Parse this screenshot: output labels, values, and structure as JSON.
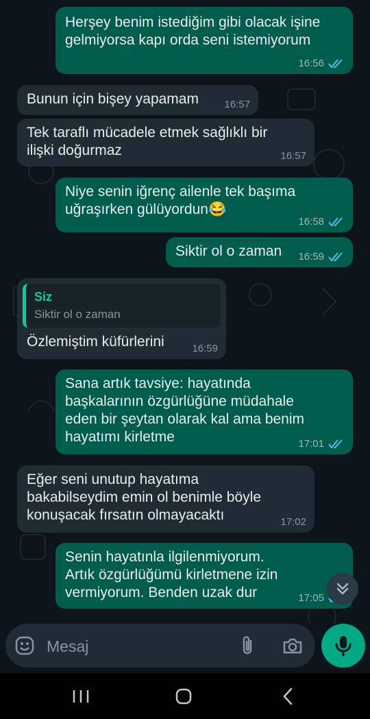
{
  "messages": [
    {
      "text": "Herşey benim istediğim gibi olacak işine gelmiyorsa kapı orda seni istemiyorum",
      "time": "16:56"
    },
    {
      "text": "Bunun için bişey yapamam",
      "time": "16:57"
    },
    {
      "text": "Tek taraflı mücadele etmek sağlıklı bir ilişki doğurmaz",
      "time": "16:57"
    },
    {
      "text": "Niye senin iğrenç ailenle tek başıma uğraşırken gülüyordun😂",
      "time": "16:58"
    },
    {
      "text": "Siktir ol o zaman",
      "time": "16:59"
    },
    {
      "quote_name": "Siz",
      "quote_text": "Siktir ol o zaman",
      "text": "Özlemiştim küfürlerini",
      "time": "16:59"
    },
    {
      "text": "Sana artık tavsiye: hayatında başkalarının özgürlüğüne müdahale eden bir şeytan olarak kal ama benim hayatımı kirletme",
      "time": "17:01"
    },
    {
      "text": "Eğer seni unutup hayatıma bakabilseydim emin ol benimle böyle konuşacak fırsatın olmayacaktı",
      "time": "17:02"
    },
    {
      "text": "Senin hayatınla ilgilenmiyorum. Artık özgürlüğümü kirletmene izin vermiyorum. Benden uzak dur",
      "time": "17:05"
    }
  ],
  "input": {
    "placeholder": "Mesaj"
  },
  "colors": {
    "outgoing": "#005c4b",
    "incoming": "#202c33",
    "accent": "#00a884",
    "read_ticks": "#53bdeb"
  },
  "icons": {
    "emoji": "emoji-icon",
    "attach": "paperclip-icon",
    "camera": "camera-icon",
    "mic": "microphone-icon",
    "scroll": "double-chevron-down-icon"
  }
}
